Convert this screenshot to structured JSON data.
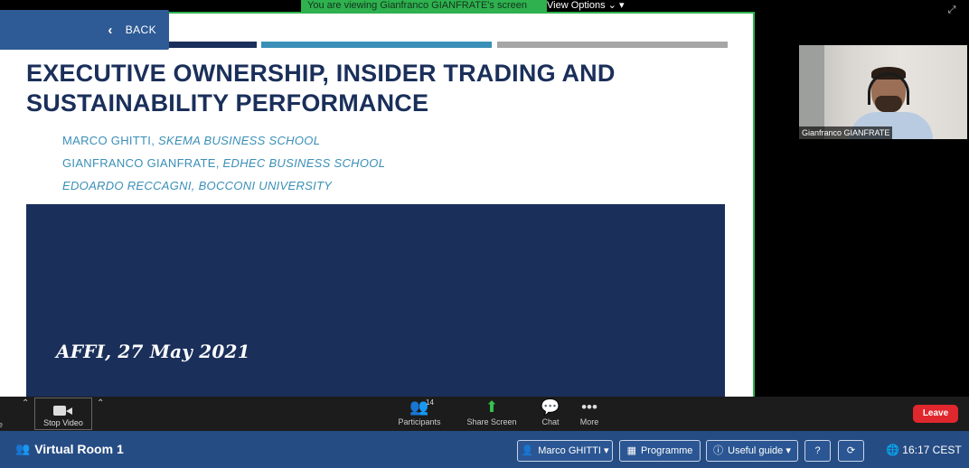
{
  "banner": {
    "viewing_text": "You are viewing Gianfranco GIANFRATE's screen",
    "view_options_label": "View Options"
  },
  "back": {
    "label": "BACK"
  },
  "slide": {
    "title": "EXECUTIVE OWNERSHIP, INSIDER TRADING AND SUSTAINABILITY PERFORMANCE",
    "authors": [
      {
        "name": "MARCO GHITTI, ",
        "affiliation": "SKEMA BUSINESS SCHOOL"
      },
      {
        "name": "GIANFRANCO GIANFRATE, ",
        "affiliation": "EDHEC BUSINESS SCHOOL"
      },
      {
        "name": "",
        "affiliation": "EDOARDO RECCAGNI, BOCCONI UNIVERSITY"
      }
    ],
    "date_line": "AFFI, 27 May 2021",
    "colors": {
      "navy": "#1a2f5a",
      "teal": "#3a8fb7",
      "grey": "#a6a6a6"
    }
  },
  "webcam": {
    "participant_name": "Gianfranco GIANFRATE"
  },
  "toolbar": {
    "cut_label": "e",
    "stop_video_label": "Stop Video",
    "participants_label": "Participants",
    "participants_count": "14",
    "share_screen_label": "Share Screen",
    "chat_label": "Chat",
    "more_label": "More",
    "leave_label": "Leave"
  },
  "room_bar": {
    "room_name": "Virtual Room 1",
    "user_label": "Marco GHITTI",
    "programme_label": "Programme",
    "useful_guide_label": "Useful guide",
    "help_label": "?",
    "refresh_label": "⟳",
    "time": "16:17 CEST"
  }
}
